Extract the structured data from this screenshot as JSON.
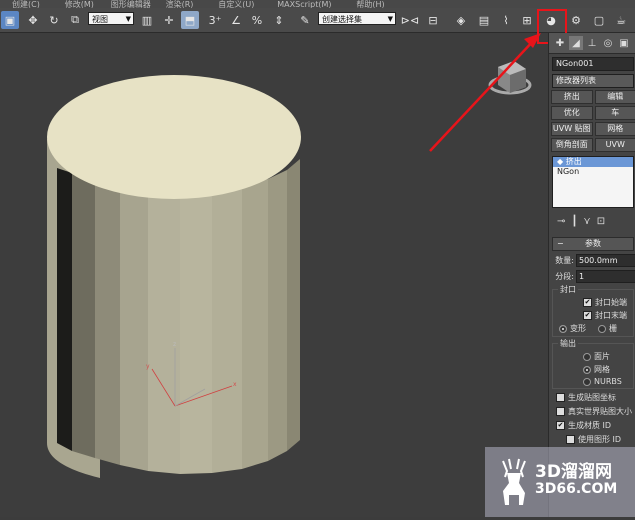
{
  "menubar": {
    "items": [
      "创建(C)",
      "修改(M)",
      "图形编辑器",
      "渲染(R)",
      "自定义(U)",
      "MAXScript(M)",
      "帮助(H)"
    ]
  },
  "toolbar": {
    "view_combo": "视图",
    "selection_set_combo": "创建选择集"
  },
  "panel": {
    "object_name": "NGon001",
    "modifier_list": "修改器列表",
    "modifier_buttons": [
      [
        "挤出",
        "编辑"
      ],
      [
        "优化",
        "车"
      ],
      [
        "UVW 贴图",
        "网格"
      ],
      [
        "倒角剖面",
        "UVW"
      ]
    ],
    "stack": [
      "挤出",
      "NGon"
    ],
    "rollout_title": "参数",
    "amount_label": "数量:",
    "amount_value": "500.0mm",
    "segments_label": "分段:",
    "segments_value": "1",
    "capping_title": "封口",
    "cap_start": "封口始端",
    "cap_end": "封口末端",
    "morph": "变形",
    "grid_partial": "栅",
    "output_title": "输出",
    "output_patch": "面片",
    "output_mesh": "网格",
    "output_nurbs": "NURBS",
    "gen_map_coords": "生成贴图坐标",
    "real_world_map": "真实世界贴图大小",
    "gen_material_ids": "生成材质 ID",
    "use_shape_ids": "使用图形 ID"
  },
  "watermark": {
    "brand": "3D溜溜网",
    "url": "3D66.COM"
  },
  "colors": {
    "highlight_red": "#e8141a",
    "selected_blue": "#5b86c3",
    "cylinder_top": "#e7e2c5",
    "cylinder_side": "#b4b19a"
  }
}
